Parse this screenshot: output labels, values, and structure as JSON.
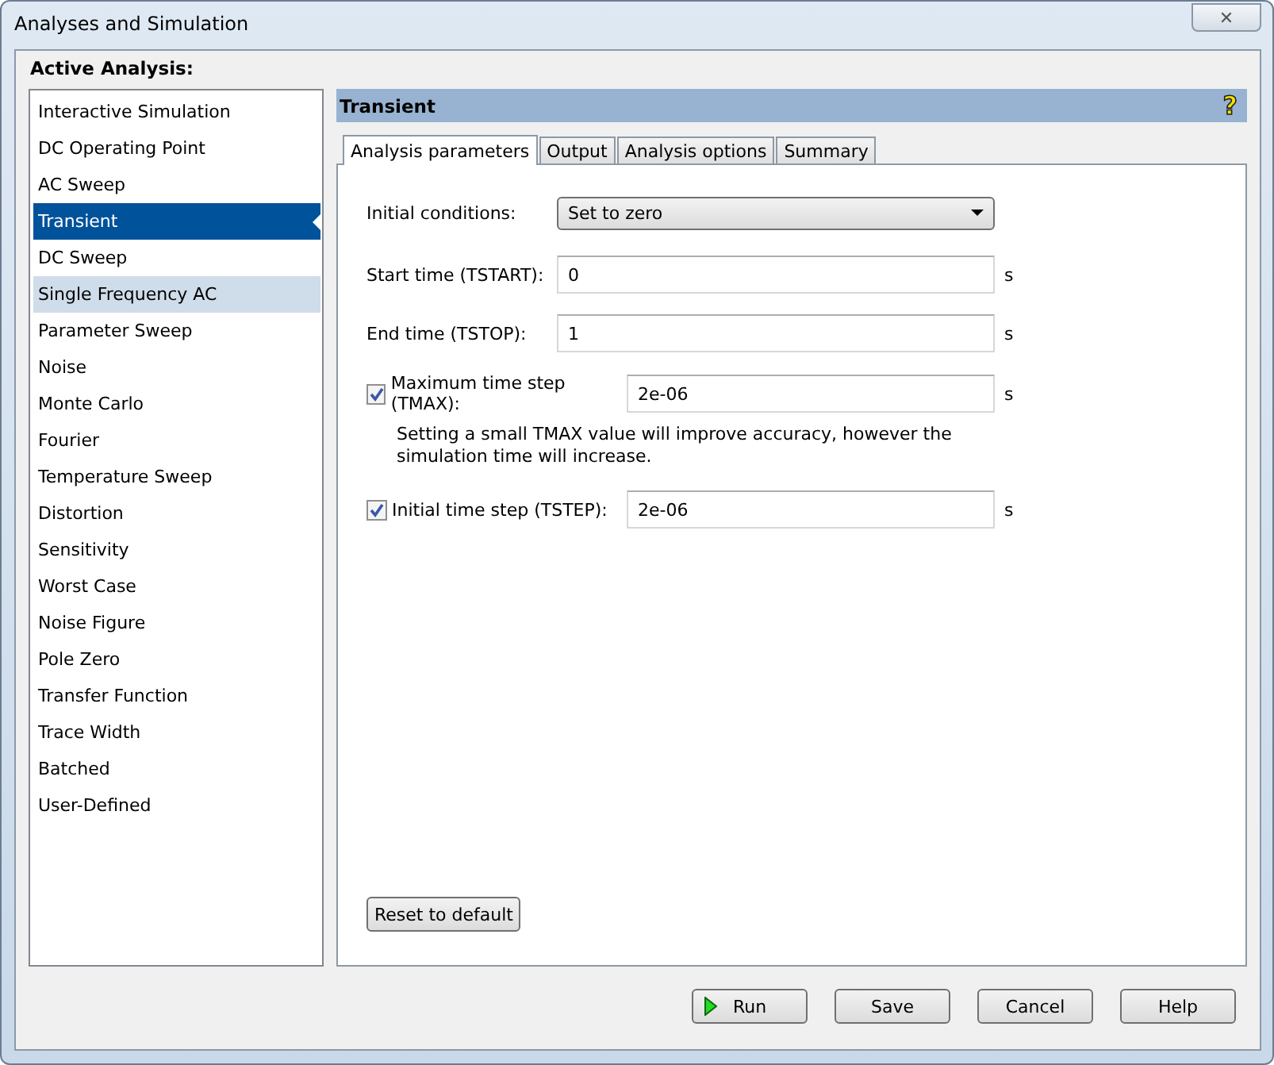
{
  "window": {
    "title": "Analyses and Simulation",
    "close": "✕"
  },
  "sidebar": {
    "title": "Active Analysis:",
    "items": [
      {
        "label": "Interactive Simulation",
        "selected": false,
        "hovered": false
      },
      {
        "label": "DC Operating Point",
        "selected": false,
        "hovered": false
      },
      {
        "label": "AC Sweep",
        "selected": false,
        "hovered": false
      },
      {
        "label": "Transient",
        "selected": true,
        "hovered": false
      },
      {
        "label": "DC Sweep",
        "selected": false,
        "hovered": false
      },
      {
        "label": "Single Frequency AC",
        "selected": false,
        "hovered": true
      },
      {
        "label": "Parameter Sweep",
        "selected": false,
        "hovered": false
      },
      {
        "label": "Noise",
        "selected": false,
        "hovered": false
      },
      {
        "label": "Monte Carlo",
        "selected": false,
        "hovered": false
      },
      {
        "label": "Fourier",
        "selected": false,
        "hovered": false
      },
      {
        "label": "Temperature Sweep",
        "selected": false,
        "hovered": false
      },
      {
        "label": "Distortion",
        "selected": false,
        "hovered": false
      },
      {
        "label": "Sensitivity",
        "selected": false,
        "hovered": false
      },
      {
        "label": "Worst Case",
        "selected": false,
        "hovered": false
      },
      {
        "label": "Noise Figure",
        "selected": false,
        "hovered": false
      },
      {
        "label": "Pole Zero",
        "selected": false,
        "hovered": false
      },
      {
        "label": "Transfer Function",
        "selected": false,
        "hovered": false
      },
      {
        "label": "Trace Width",
        "selected": false,
        "hovered": false
      },
      {
        "label": "Batched",
        "selected": false,
        "hovered": false
      },
      {
        "label": "User-Defined",
        "selected": false,
        "hovered": false
      }
    ]
  },
  "panel": {
    "title": "Transient",
    "help": "?",
    "tabs": [
      {
        "label": "Analysis parameters",
        "selected": true
      },
      {
        "label": "Output",
        "selected": false
      },
      {
        "label": "Analysis options",
        "selected": false
      },
      {
        "label": "Summary",
        "selected": false
      }
    ],
    "fields": [
      {
        "kind": "select",
        "label": "Initial conditions:",
        "value": "Set to zero"
      },
      {
        "kind": "text",
        "label": "Start time (TSTART):",
        "value": "0",
        "unit": "s"
      },
      {
        "kind": "text",
        "label": "End time (TSTOP):",
        "value": "1",
        "unit": "s"
      },
      {
        "kind": "check",
        "label": "Maximum time step (TMAX):",
        "checked": true,
        "value": "2e-06",
        "unit": "s"
      },
      {
        "kind": "note",
        "text": "Setting a small TMAX value will improve accuracy, however the simulation time will increase."
      },
      {
        "kind": "check",
        "label": "Initial time step (TSTEP):",
        "checked": true,
        "value": "2e-06",
        "unit": "s"
      }
    ],
    "reset": "Reset to default"
  },
  "buttons": [
    {
      "label": "Run",
      "kind": "run"
    },
    {
      "label": "Save",
      "kind": "plain"
    },
    {
      "label": "Cancel",
      "kind": "plain"
    },
    {
      "label": "Help",
      "kind": "plain"
    }
  ]
}
